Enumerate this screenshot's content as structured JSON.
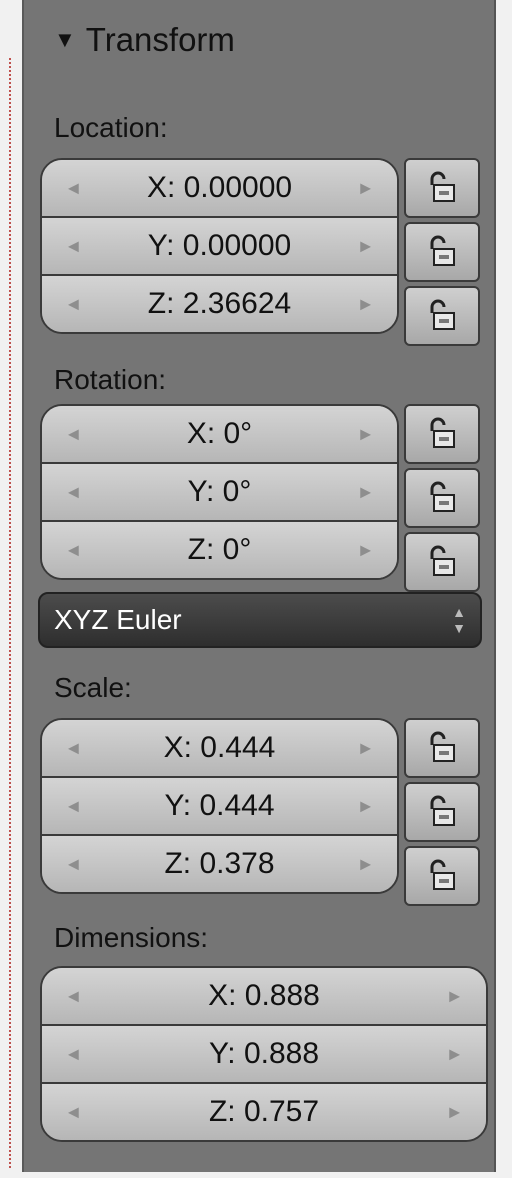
{
  "panel": {
    "title": "Transform"
  },
  "location": {
    "label": "Location:",
    "x": "X: 0.00000",
    "y": "Y: 0.00000",
    "z": "Z: 2.36624"
  },
  "rotation": {
    "label": "Rotation:",
    "x": "X: 0°",
    "y": "Y: 0°",
    "z": "Z: 0°",
    "mode": "XYZ Euler"
  },
  "scale": {
    "label": "Scale:",
    "x": "X: 0.444",
    "y": "Y: 0.444",
    "z": "Z: 0.378"
  },
  "dimensions": {
    "label": "Dimensions:",
    "x": "X: 0.888",
    "y": "Y: 0.888",
    "z": "Z: 0.757"
  },
  "icons": {
    "collapse": "triangle-down-icon",
    "decrement": "arrow-left-icon",
    "increment": "arrow-right-icon",
    "lock": "padlock-icon",
    "dropdown": "updown-arrows-icon"
  },
  "colors": {
    "panel_bg": "#757575",
    "field_bg": "#c8c8c8",
    "dropdown_bg": "#3b3b3b"
  }
}
